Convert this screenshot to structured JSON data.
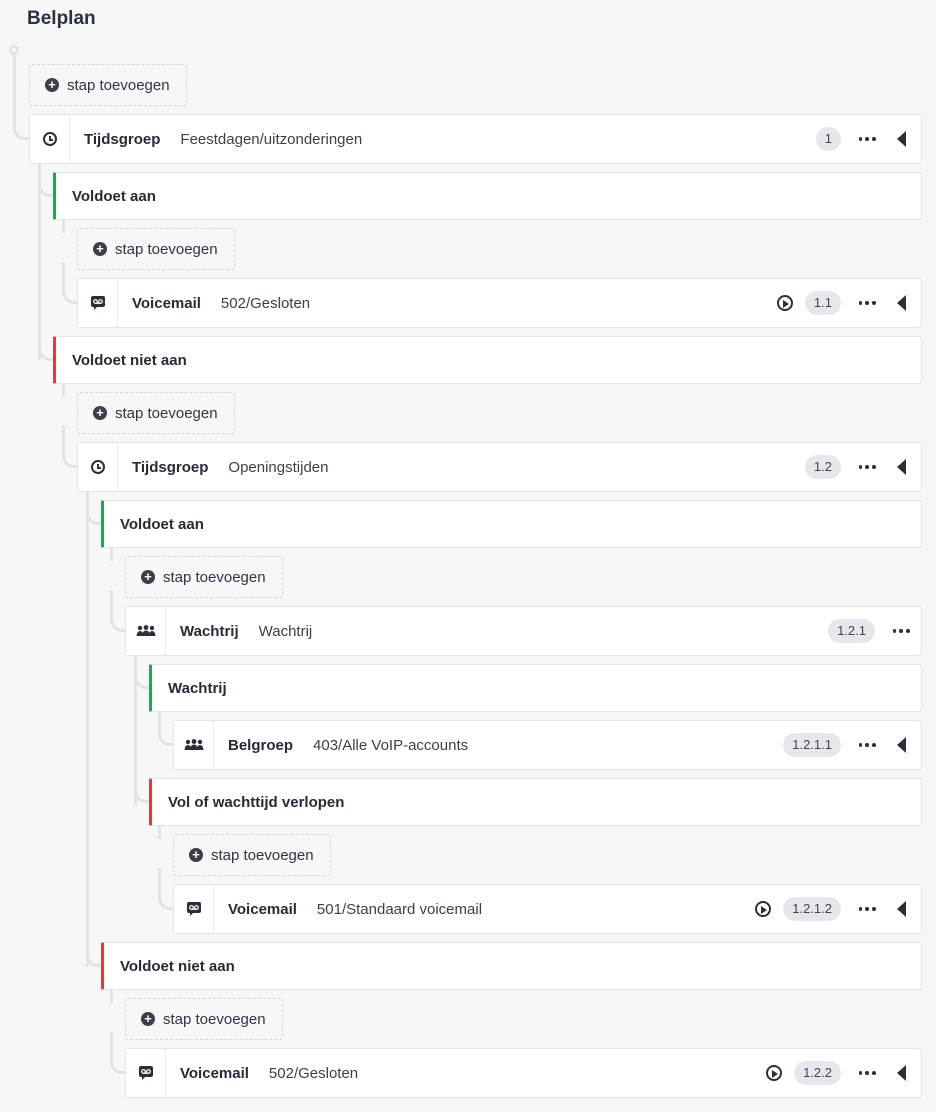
{
  "page": {
    "title": "Belplan"
  },
  "add_step_label": "stap toevoegen",
  "steps": {
    "s1": {
      "type": "Tijdsgroep",
      "desc": "Feestdagen/uitzonderingen",
      "badge": "1"
    },
    "s11": {
      "type": "Voicemail",
      "desc": "502/Gesloten",
      "badge": "1.1"
    },
    "s12": {
      "type": "Tijdsgroep",
      "desc": "Openingstijden",
      "badge": "1.2"
    },
    "s121": {
      "type": "Wachtrij",
      "desc": "Wachtrij",
      "badge": "1.2.1"
    },
    "s1211": {
      "type": "Belgroep",
      "desc": "403/Alle VoIP-accounts",
      "badge": "1.2.1.1"
    },
    "s1212": {
      "type": "Voicemail",
      "desc": "501/Standaard voicemail",
      "badge": "1.2.1.2"
    },
    "s122": {
      "type": "Voicemail",
      "desc": "502/Gesloten",
      "badge": "1.2.2"
    }
  },
  "conditions": {
    "c1_yes": "Voldoet aan",
    "c1_no": "Voldoet niet aan",
    "c12_yes": "Voldoet aan",
    "c121_queue": "Wachtrij",
    "c121_full": "Vol of wachttijd verlopen",
    "c12_no": "Voldoet niet aan"
  },
  "colors": {
    "match": "#22a551",
    "nomatch": "#e03c3c",
    "connector": "#e1e3e6"
  },
  "icons": {
    "tijdsgroep": "clock-icon",
    "voicemail": "voicemail-icon",
    "wachtrij": "group-icon",
    "belgroep": "group-icon",
    "add": "plus-circle-icon",
    "play": "play-icon",
    "more": "more-horizontal-icon",
    "collapse": "caret-left-icon"
  }
}
